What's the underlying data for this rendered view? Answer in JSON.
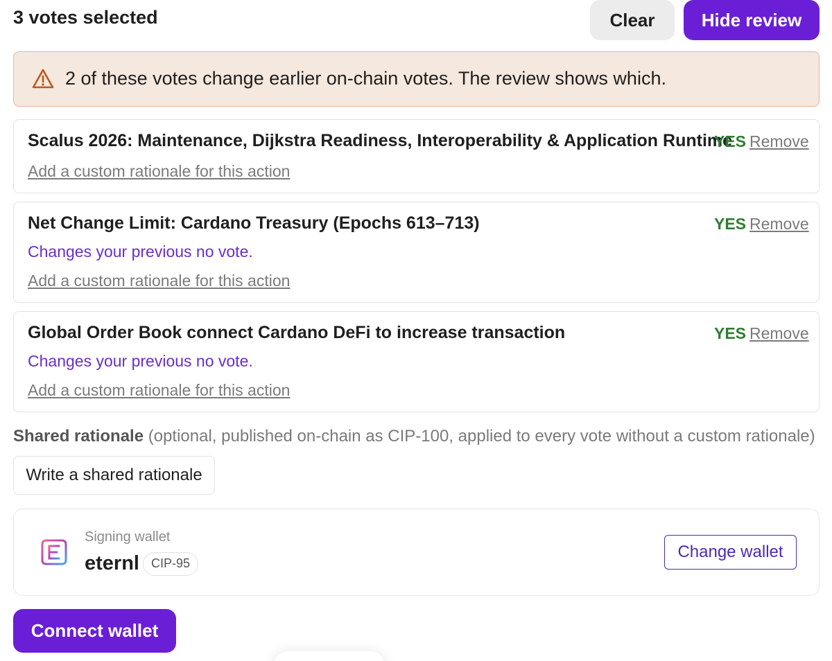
{
  "header": {
    "votes_selected": "3 votes selected",
    "clear_label": "Clear",
    "hide_review_label": "Hide review"
  },
  "warning": {
    "icon": "warning-triangle-icon",
    "text": "2 of these votes change earlier on-chain votes. The review shows which."
  },
  "votes": [
    {
      "title": "Scalus 2026: Maintenance, Dijkstra Readiness, Interoperability & Application Runtime",
      "change_note": "",
      "rationale_link": "Add a custom rationale for this action",
      "vote": "YES",
      "remove_label": "Remove"
    },
    {
      "title": "Net Change Limit: Cardano Treasury (Epochs 613–713)",
      "change_note": "Changes your previous no vote.",
      "rationale_link": "Add a custom rationale for this action",
      "vote": "YES",
      "remove_label": "Remove"
    },
    {
      "title": "Global Order Book connect Cardano DeFi to increase transaction",
      "change_note": "Changes your previous no vote.",
      "rationale_link": "Add a custom rationale for this action",
      "vote": "YES",
      "remove_label": "Remove"
    }
  ],
  "shared_rationale": {
    "label": "Shared rationale",
    "hint": "(optional, published on-chain as CIP-100, applied to every vote without a custom rationale)",
    "button_label": "Write a shared rationale"
  },
  "wallet": {
    "subtitle": "Signing wallet",
    "name": "eternl",
    "badge": "CIP-95",
    "logo_icon": "eternl-logo-icon",
    "change_label": "Change wallet"
  },
  "connect_label": "Connect wallet",
  "colors": {
    "primary": "#6a1fd6",
    "yes": "#2e7d32",
    "change_note": "#6a2fc6",
    "warning_bg": "#f4e8df",
    "warning_border": "#e4b79b"
  }
}
